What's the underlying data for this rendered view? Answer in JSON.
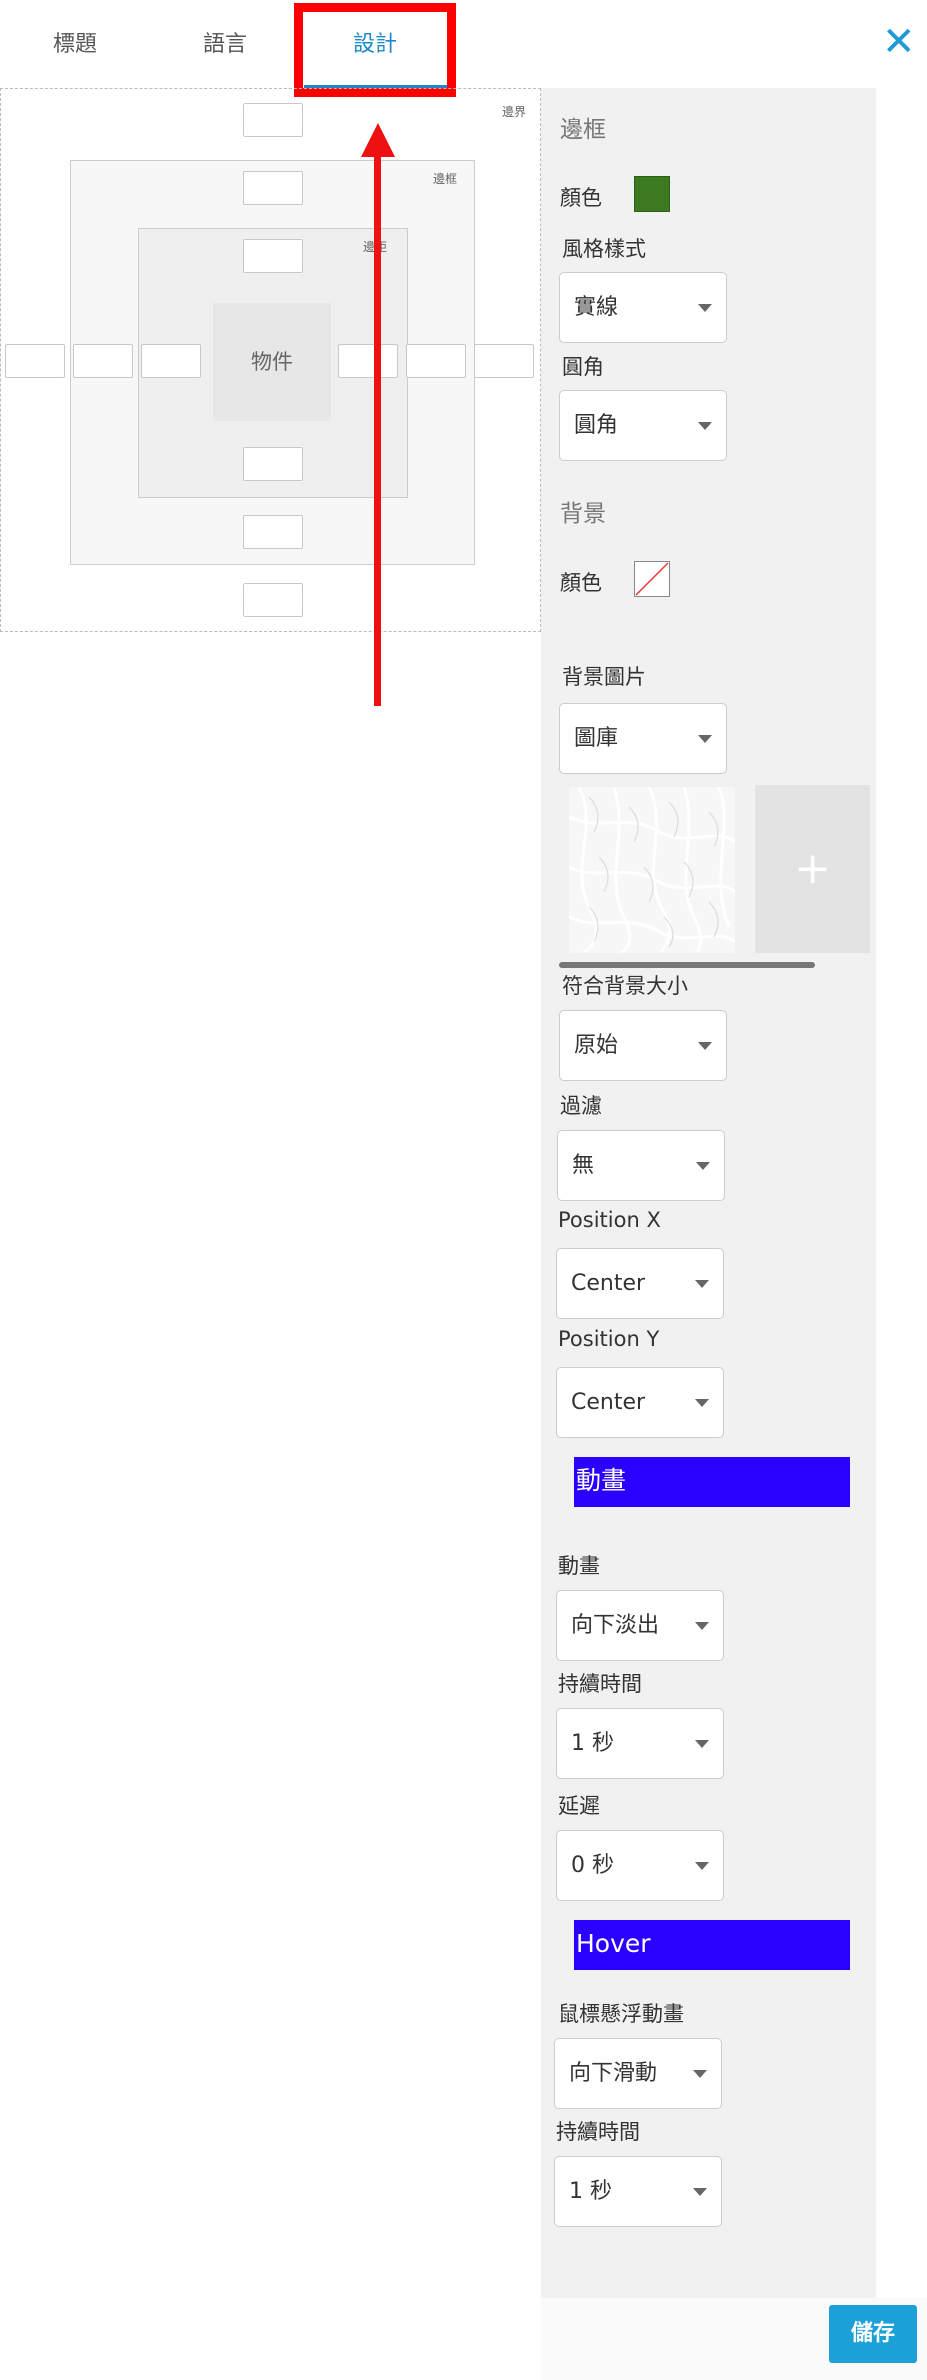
{
  "tabs": [
    {
      "label": "標題"
    },
    {
      "label": "語言"
    },
    {
      "label": "設計"
    }
  ],
  "close_icon": "✕",
  "box_model": {
    "margin_label": "邊界",
    "border_label": "邊框",
    "padding_label": "邊距",
    "object_label": "物件"
  },
  "panel": {
    "border_section": "邊框",
    "color_label": "顏色",
    "border_color": "#3b7a1e",
    "border_style_label": "風格樣式",
    "border_style_value": "實線",
    "radius_label": "圓角",
    "radius_value": "圓角",
    "background_section": "背景",
    "bg_color_label": "顏色",
    "bg_image_label": "背景圖片",
    "bg_image_value": "圖庫",
    "add_symbol": "+",
    "fit_label": "符合背景大小",
    "fit_value": "原始",
    "filter_label": "過濾",
    "filter_value": "無",
    "posx_label": "Position X",
    "posx_value": "Center",
    "posy_label": "Position Y",
    "posy_value": "Center",
    "animation_header": "動畫",
    "animation_label": "動畫",
    "animation_value": "向下淡出",
    "duration_label": "持續時間",
    "duration_value": "1 秒",
    "delay_label": "延遲",
    "delay_value": "0 秒",
    "hover_header": "Hover",
    "hover_anim_label": "鼠標懸浮動畫",
    "hover_anim_value": "向下滑動",
    "hover_duration_label": "持續時間",
    "hover_duration_value": "1 秒",
    "save_label": "儲存",
    "accent_color": "#2a00ff"
  }
}
